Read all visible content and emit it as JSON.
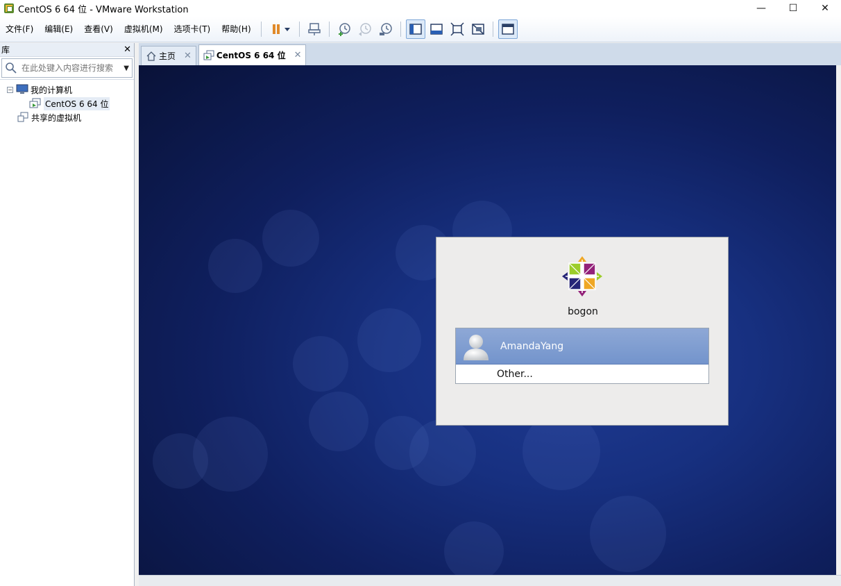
{
  "window": {
    "title": "CentOS 6 64 位 - VMware Workstation",
    "controls": {
      "minimize": "—",
      "maximize": "☐",
      "close": "✕"
    }
  },
  "menu": {
    "items": [
      "文件(F)",
      "编辑(E)",
      "查看(V)",
      "虚拟机(M)",
      "选项卡(T)",
      "帮助(H)"
    ]
  },
  "toolbar": {
    "buttons": [
      "pause-icon",
      "send-ctrl-alt-del-icon",
      "snapshot-icon",
      "revert-snapshot-icon",
      "snapshot-manager-icon",
      "normal-view-icon",
      "quick-switch-icon",
      "fullscreen-icon",
      "unity-icon",
      "console-view-icon"
    ],
    "accent": "#e08a2a"
  },
  "library": {
    "title": "库",
    "close": "✕",
    "search_placeholder": "在此处键入内容进行搜索",
    "tree": [
      {
        "label": "我的计算机",
        "toggle": "−"
      },
      {
        "label": "CentOS 6 64 位"
      },
      {
        "label": "共享的虚拟机"
      }
    ]
  },
  "tabs": [
    {
      "label": "主页",
      "close": "✕"
    },
    {
      "label": "CentOS 6 64 位",
      "close": "✕"
    }
  ],
  "login": {
    "hostname": "bogon",
    "user": "AmandaYang",
    "other": "Other..."
  },
  "colors": {
    "desktop": "#14286e",
    "selected_user": "#7e9dd0"
  }
}
